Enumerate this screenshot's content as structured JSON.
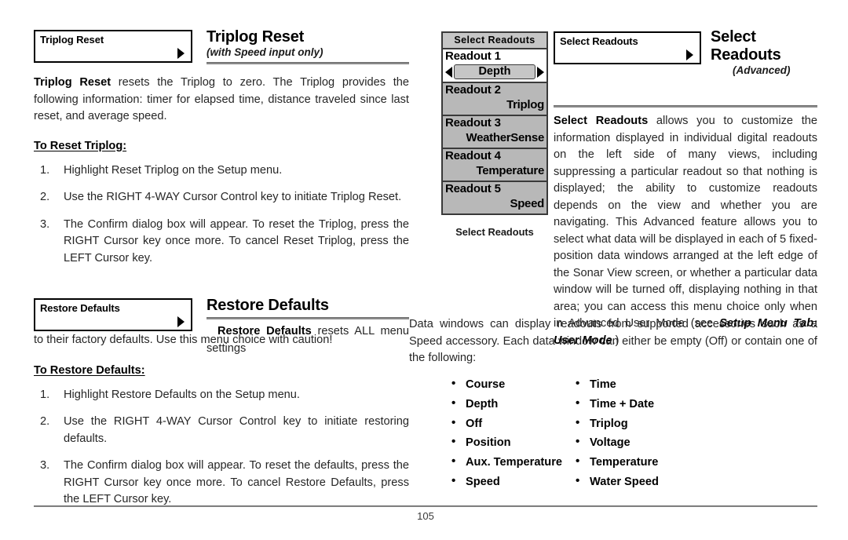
{
  "page": {
    "number": "105"
  },
  "left_column": {
    "section1": {
      "menu_chip": {
        "label": "Triplog Reset",
        "arrow_icon": "right-triangle-icon"
      },
      "heading": "Triplog Reset",
      "subheading": "(with Speed input only)",
      "intro_bold": "Triplog Reset",
      "intro_rest": " resets the Triplog to zero. The Triplog provides the following information: timer for elapsed time, distance traveled since last reset, and average speed.",
      "procedure_heading": "To Reset Triplog:",
      "steps": [
        {
          "num": "1.",
          "text": "Highlight Reset Triplog on the Setup menu."
        },
        {
          "num": "2.",
          "text": "Use the RIGHT 4-WAY Cursor Control key to initiate Triplog Reset."
        },
        {
          "num": "3.",
          "text": "The Confirm dialog box will appear. To reset the Triplog, press the RIGHT Cursor key once more. To cancel Reset Triplog, press the LEFT Cursor key."
        }
      ]
    },
    "section2": {
      "menu_chip": {
        "label": "Restore Defaults",
        "arrow_icon": "right-triangle-icon"
      },
      "heading": "Restore Defaults",
      "intro_bold": "Restore Defaults",
      "intro_rest": " resets ALL menu settings to their factory defaults. Use this menu choice with caution!",
      "procedure_heading": "To Restore Defaults:",
      "steps": [
        {
          "num": "1.",
          "text": "Highlight Restore Defaults on the Setup menu."
        },
        {
          "num": "2.",
          "text": "Use the RIGHT 4-WAY Cursor Control key to initiate restoring defaults."
        },
        {
          "num": "3.",
          "text": "The Confirm dialog box will appear. To reset the defaults, press the RIGHT Cursor key once more. To cancel Restore Defaults, press the LEFT Cursor key."
        }
      ]
    }
  },
  "lcd_screenshot": {
    "title": "Select Readouts",
    "caption": "Select Readouts",
    "left_caret_icon": "left-triangle-icon",
    "right_caret_icon": "right-triangle-icon",
    "rows": [
      {
        "name": "Readout 1",
        "value": "Depth",
        "state": "active"
      },
      {
        "name": "Readout 2",
        "value": "Triplog",
        "state": "dim"
      },
      {
        "name": "Readout 3",
        "value": "WeatherSense",
        "state": "dim"
      },
      {
        "name": "Readout 4",
        "value": "Temperature",
        "state": "dim"
      },
      {
        "name": "Readout 5",
        "value": "Speed",
        "state": "dim"
      }
    ]
  },
  "right_column": {
    "menu_chip": {
      "label": "Select Readouts",
      "arrow_icon": "right-triangle-icon"
    },
    "heading_line1": "Select",
    "heading_line2": "Readouts",
    "subheading": "(Advanced)",
    "intro_bold": "Select Readouts",
    "intro_rest": " allows you to customize the information displayed in individual digital readouts on the left side of many views, including suppressing a particular readout so that nothing is displayed; the ability to customize readouts depends on the view and whether you are navigating. This Advanced feature allows you to select what data will be displayed in each of 5 fixed-position data windows arranged at the left edge of the Sonar View screen, or whether a particular data window will be turned off, displaying nothing in that area; you can access this menu choice only when in Advanced User Mode (see ",
    "cross_reference": "Setup Menu Tab: User Mode",
    "intro_tail": ".)",
    "paragraph2": "Data windows can display readouts from supported accessories such as a Speed accessory. Each data window can either be empty (Off) or contain one of the following:",
    "bullets_column1": [
      "Course",
      "Depth",
      "Off",
      "Position",
      "Aux. Temperature",
      "Speed"
    ],
    "bullets_column2": [
      "Time",
      "Time + Date",
      "Triplog",
      "Voltage",
      "Temperature",
      "Water Speed"
    ]
  },
  "colors": {
    "rule": "#8a8a8a",
    "lcd_background": "#b8b8b8",
    "lcd_title_bar": "#c6c6c6",
    "lcd_active_row": "#ffffff",
    "text": "#262626"
  }
}
